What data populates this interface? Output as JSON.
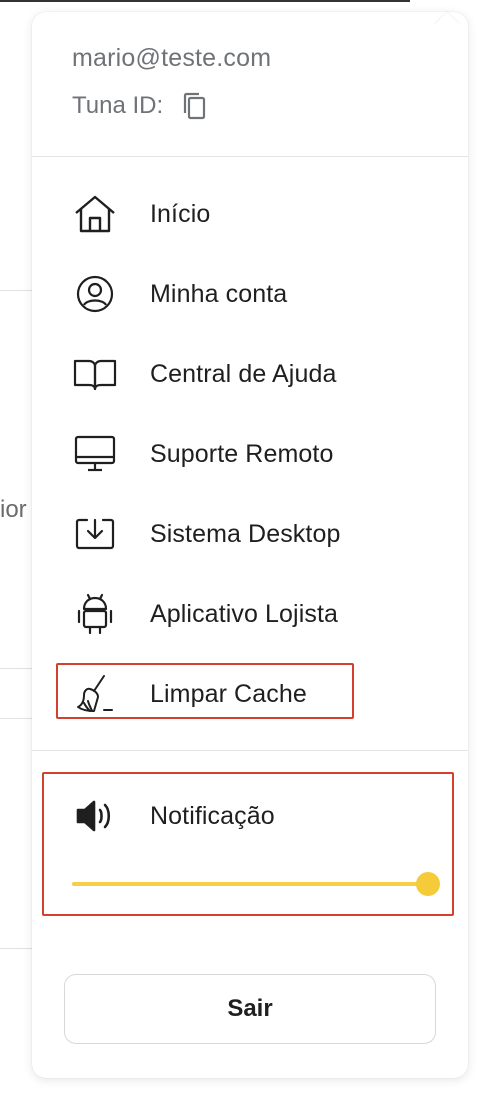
{
  "user": {
    "email": "mario@teste.com",
    "tuna_label": "Tuna ID:"
  },
  "menu_items": [
    {
      "label": "Início",
      "icon": "home-icon"
    },
    {
      "label": "Minha conta",
      "icon": "user-circle-icon"
    },
    {
      "label": "Central de Ajuda",
      "icon": "book-icon"
    },
    {
      "label": "Suporte Remoto",
      "icon": "monitor-icon"
    },
    {
      "label": "Sistema Desktop",
      "icon": "download-box-icon"
    },
    {
      "label": "Aplicativo Lojista",
      "icon": "android-icon"
    },
    {
      "label": "Limpar Cache",
      "icon": "broom-icon"
    }
  ],
  "notification": {
    "label": "Notificação",
    "icon": "speaker-icon",
    "volume": 1.0
  },
  "logout": {
    "label": "Sair"
  },
  "background": {
    "partial_text": "ior"
  },
  "colors": {
    "accent": "#f6cb3a",
    "highlight": "#d1412e",
    "text_primary": "#1f1f1f",
    "text_secondary": "#6f7378"
  }
}
